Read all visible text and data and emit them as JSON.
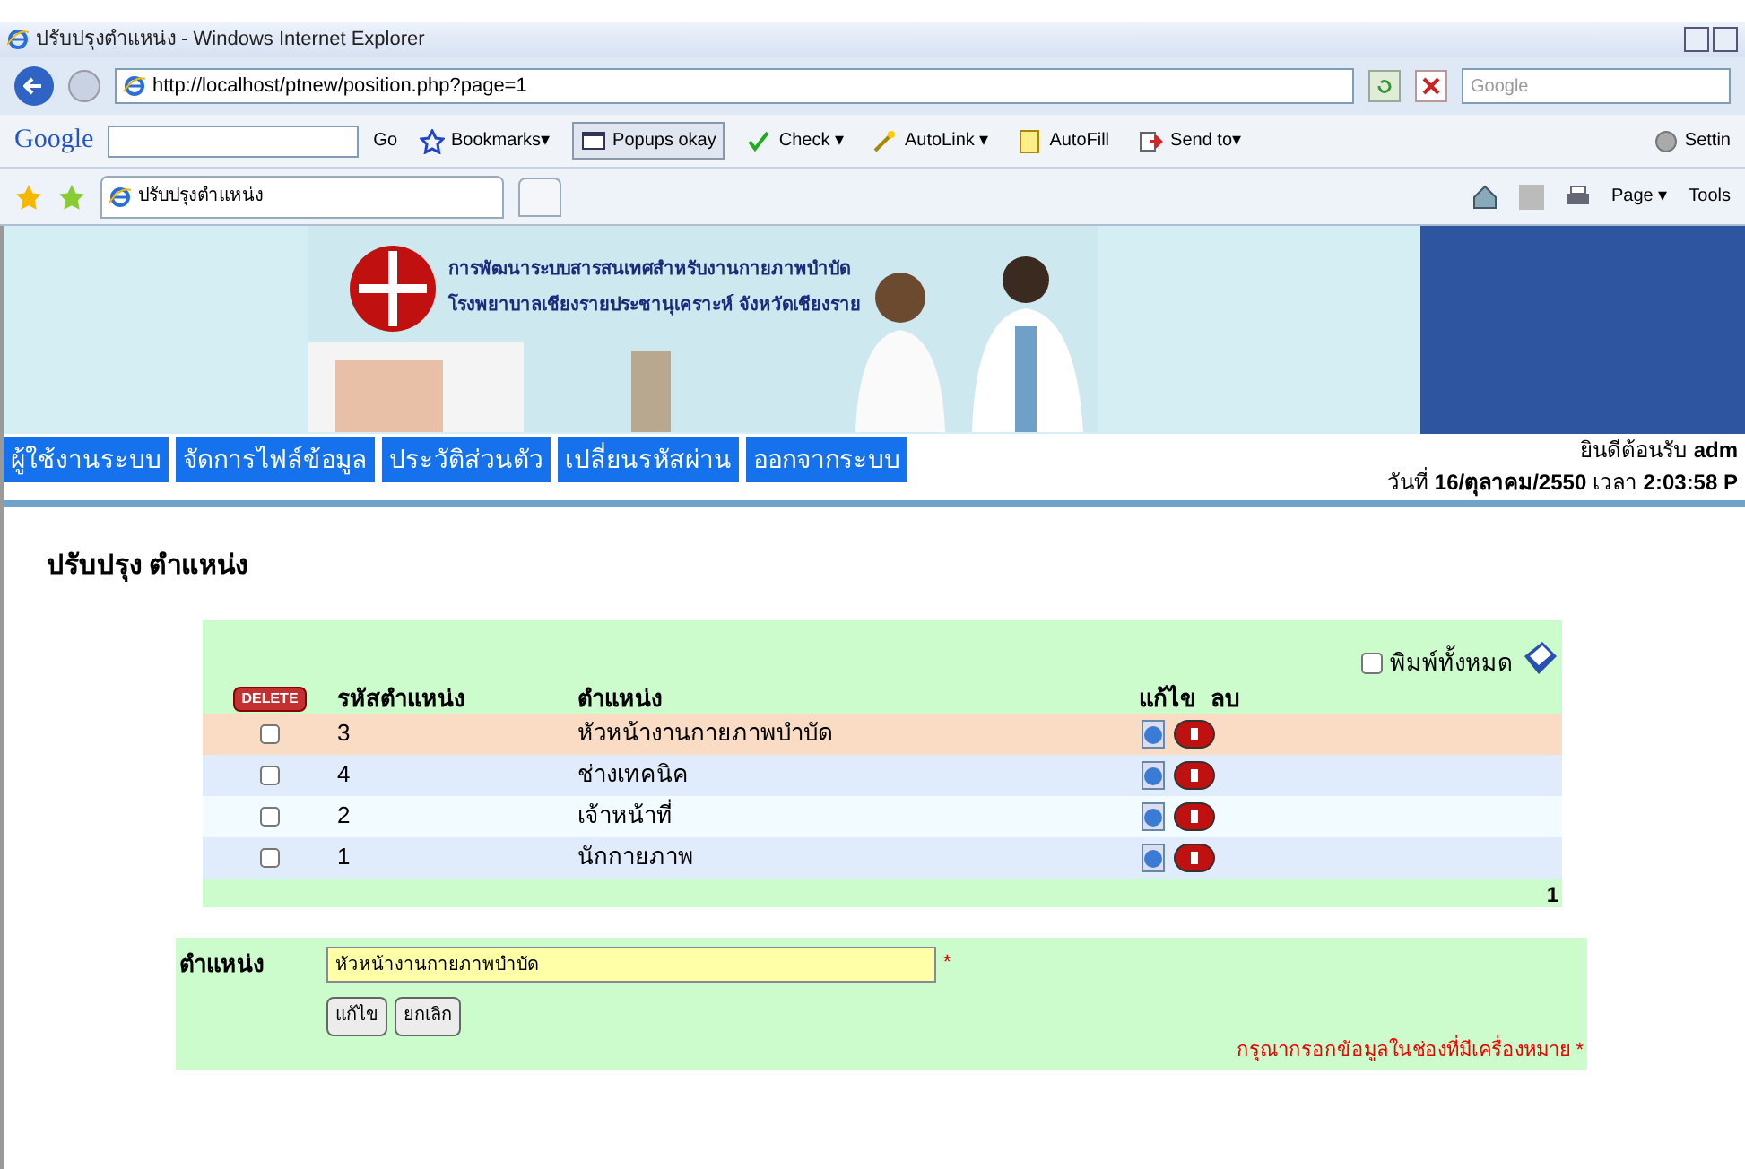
{
  "window": {
    "title": "ปรับปรุงตำแหน่ง - Windows Internet Explorer"
  },
  "address_bar": {
    "url": "http://localhost/ptnew/position.php?page=1",
    "search_placeholder": "Google"
  },
  "google_toolbar": {
    "logo": "Google",
    "go": "Go",
    "items": [
      {
        "kind": "star",
        "label": "Bookmarks▾"
      },
      {
        "kind": "popup",
        "label": "Popups okay"
      },
      {
        "kind": "check",
        "label": "Check ▾"
      },
      {
        "kind": "wand",
        "label": "AutoLink ▾"
      },
      {
        "kind": "fill",
        "label": "AutoFill"
      },
      {
        "kind": "send",
        "label": "Send to▾"
      }
    ],
    "settings": "Settin"
  },
  "tab_bar": {
    "tab": "ปรับปรุงตำแหน่ง",
    "tools": [
      "Page ▾",
      "Tools"
    ]
  },
  "header": {
    "lines": [
      "การพัฒนาระบบสารสนเทศสำหรับงานกายภาพบำบัด",
      "โรงพยาบาลเชียงรายประชานุเคราะห์  จังหวัดเชียงราย"
    ]
  },
  "nav": {
    "items": [
      "ผู้ใช้งานระบบ",
      "จัดการไฟล์ข้อมูล",
      "ประวัติส่วนตัว",
      "เปลี่ยนรหัสผ่าน",
      "ออกจากระบบ"
    ],
    "welcome": "ยินดีต้อนรับ **adm**",
    "datetime": "วันที่ **16/ตุลาคม/2550** เวลา **2:03:58 P**"
  },
  "page_title": "ปรับปรุง ตำแหน่ง",
  "table": {
    "print_all": {
      "label": "พิมพ์ทั้งหมด",
      "checked": false
    },
    "delete_button": "DELETE",
    "columns": [
      "รหัสตำแหน่ง",
      "ตำแหน่ง",
      "แก้ไข",
      "ลบ"
    ],
    "rows": [
      {
        "code": "3",
        "name": "หัวหน้างานกายภาพบำบัด",
        "checked": false,
        "selected": true
      },
      {
        "code": "4",
        "name": "ช่างเทคนิค",
        "checked": false,
        "selected": false
      },
      {
        "code": "2",
        "name": "เจ้าหน้าที่",
        "checked": false,
        "selected": false
      },
      {
        "code": "1",
        "name": "นักกายภาพ",
        "checked": false,
        "selected": false
      }
    ],
    "page": "1"
  },
  "form": {
    "label": "ตำแหน่ง",
    "value": "หัวหน้างานกายภาพบำบัด",
    "required": "*",
    "buttons": [
      "แก้ไข",
      "ยกเลิก"
    ],
    "note": "กรุณากรอกข้อมูลในช่องที่มีเครื่องหมาย *"
  }
}
